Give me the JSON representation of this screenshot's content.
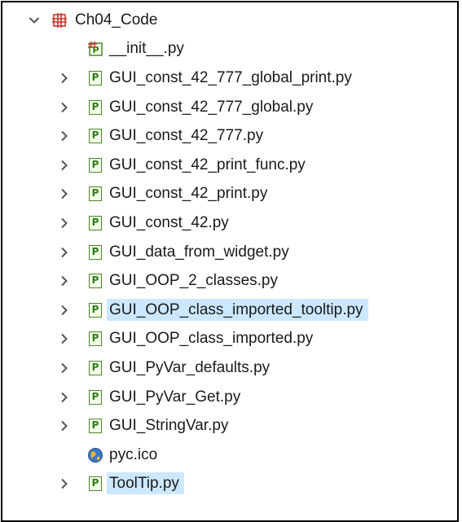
{
  "project": {
    "name": "Ch04_Code",
    "expanded": true
  },
  "items": [
    {
      "label": "__init__.py",
      "icon": "python-package-init-icon",
      "expandable": false,
      "selected": false
    },
    {
      "label": "GUI_const_42_777_global_print.py",
      "icon": "python-file-icon",
      "expandable": true,
      "selected": false
    },
    {
      "label": "GUI_const_42_777_global.py",
      "icon": "python-file-icon",
      "expandable": true,
      "selected": false
    },
    {
      "label": "GUI_const_42_777.py",
      "icon": "python-file-icon",
      "expandable": true,
      "selected": false
    },
    {
      "label": "GUI_const_42_print_func.py",
      "icon": "python-file-icon",
      "expandable": true,
      "selected": false
    },
    {
      "label": "GUI_const_42_print.py",
      "icon": "python-file-icon",
      "expandable": true,
      "selected": false
    },
    {
      "label": "GUI_const_42.py",
      "icon": "python-file-icon",
      "expandable": true,
      "selected": false
    },
    {
      "label": "GUI_data_from_widget.py",
      "icon": "python-file-icon",
      "expandable": true,
      "selected": false
    },
    {
      "label": "GUI_OOP_2_classes.py",
      "icon": "python-file-icon",
      "expandable": true,
      "selected": false
    },
    {
      "label": "GUI_OOP_class_imported_tooltip.py",
      "icon": "python-file-icon",
      "expandable": true,
      "selected": true
    },
    {
      "label": "GUI_OOP_class_imported.py",
      "icon": "python-file-icon",
      "expandable": true,
      "selected": false
    },
    {
      "label": "GUI_PyVar_defaults.py",
      "icon": "python-file-icon",
      "expandable": true,
      "selected": false
    },
    {
      "label": "GUI_PyVar_Get.py",
      "icon": "python-file-icon",
      "expandable": true,
      "selected": false
    },
    {
      "label": "GUI_StringVar.py",
      "icon": "python-file-icon",
      "expandable": true,
      "selected": false
    },
    {
      "label": "pyc.ico",
      "icon": "globe-ico-file-icon",
      "expandable": false,
      "selected": false
    },
    {
      "label": "ToolTip.py",
      "icon": "python-file-icon",
      "expandable": true,
      "selected": true
    }
  ],
  "colors": {
    "selection": "#cce8ff",
    "package_icon": "#c0392b",
    "python_icon": "#4a8a2a",
    "twisty": "#555555"
  }
}
